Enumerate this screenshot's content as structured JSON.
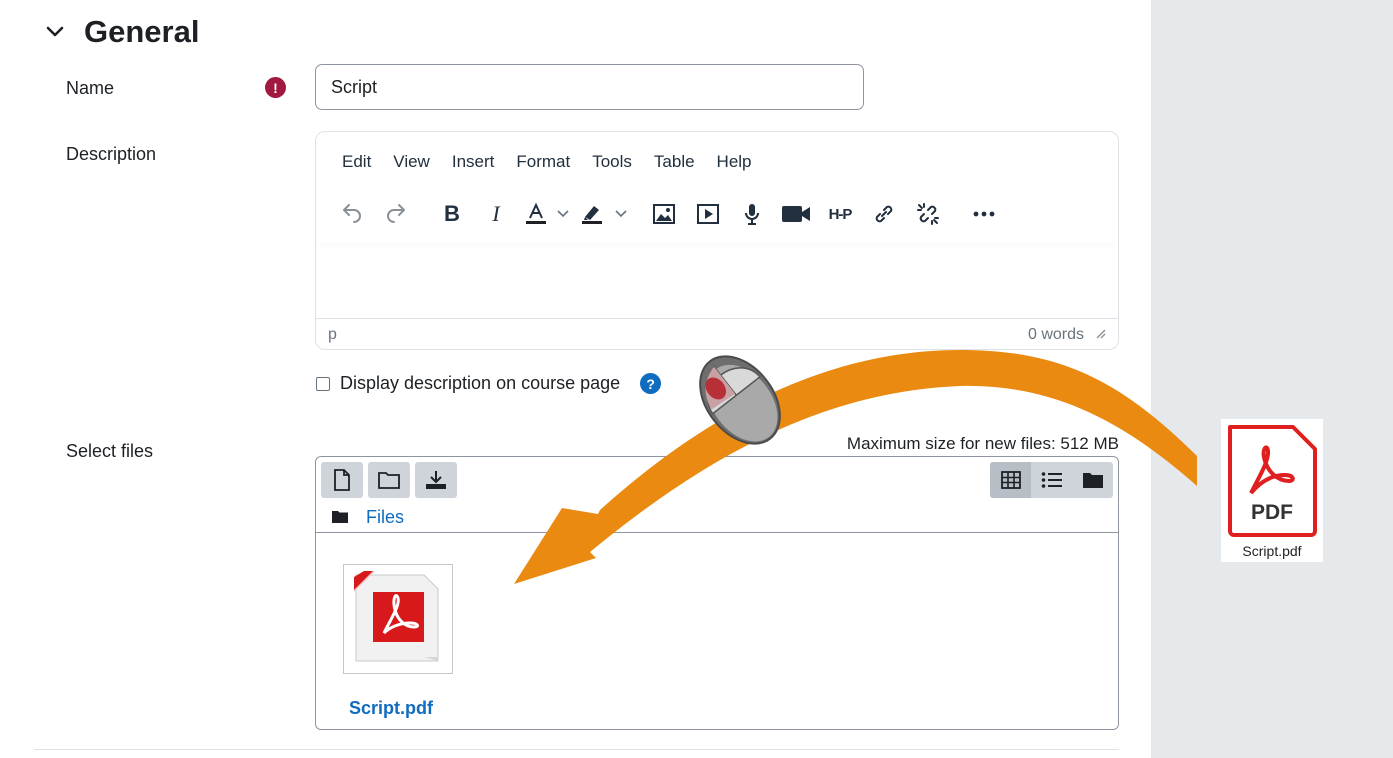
{
  "section": {
    "title": "General"
  },
  "fields": {
    "name_label": "Name",
    "name_value": "Script",
    "description_label": "Description",
    "select_files_label": "Select files"
  },
  "editor": {
    "menu": [
      "Edit",
      "View",
      "Insert",
      "Format",
      "Tools",
      "Table",
      "Help"
    ],
    "status_path": "p",
    "word_count": "0 words",
    "toolbar_icons": [
      "undo-icon",
      "redo-icon",
      "bold-icon",
      "italic-icon",
      "text-color-icon",
      "highlight-icon",
      "image-icon",
      "media-icon",
      "microphone-icon",
      "video-camera-icon",
      "h5p-icon",
      "link-icon",
      "unlink-icon",
      "more-icon"
    ]
  },
  "display_description": {
    "label": "Display description on course page",
    "checked": false
  },
  "filepicker": {
    "max_size": "Maximum size for new files: 512 MB",
    "path_label": "Files",
    "files": [
      {
        "name": "Script.pdf"
      }
    ]
  },
  "desktop_file": {
    "name": "Script.pdf",
    "badge": "PDF"
  },
  "colors": {
    "link": "#0f6cbf",
    "required": "#a2193f",
    "arrow": "#ea8a10",
    "pdf_red": "#e02020"
  }
}
